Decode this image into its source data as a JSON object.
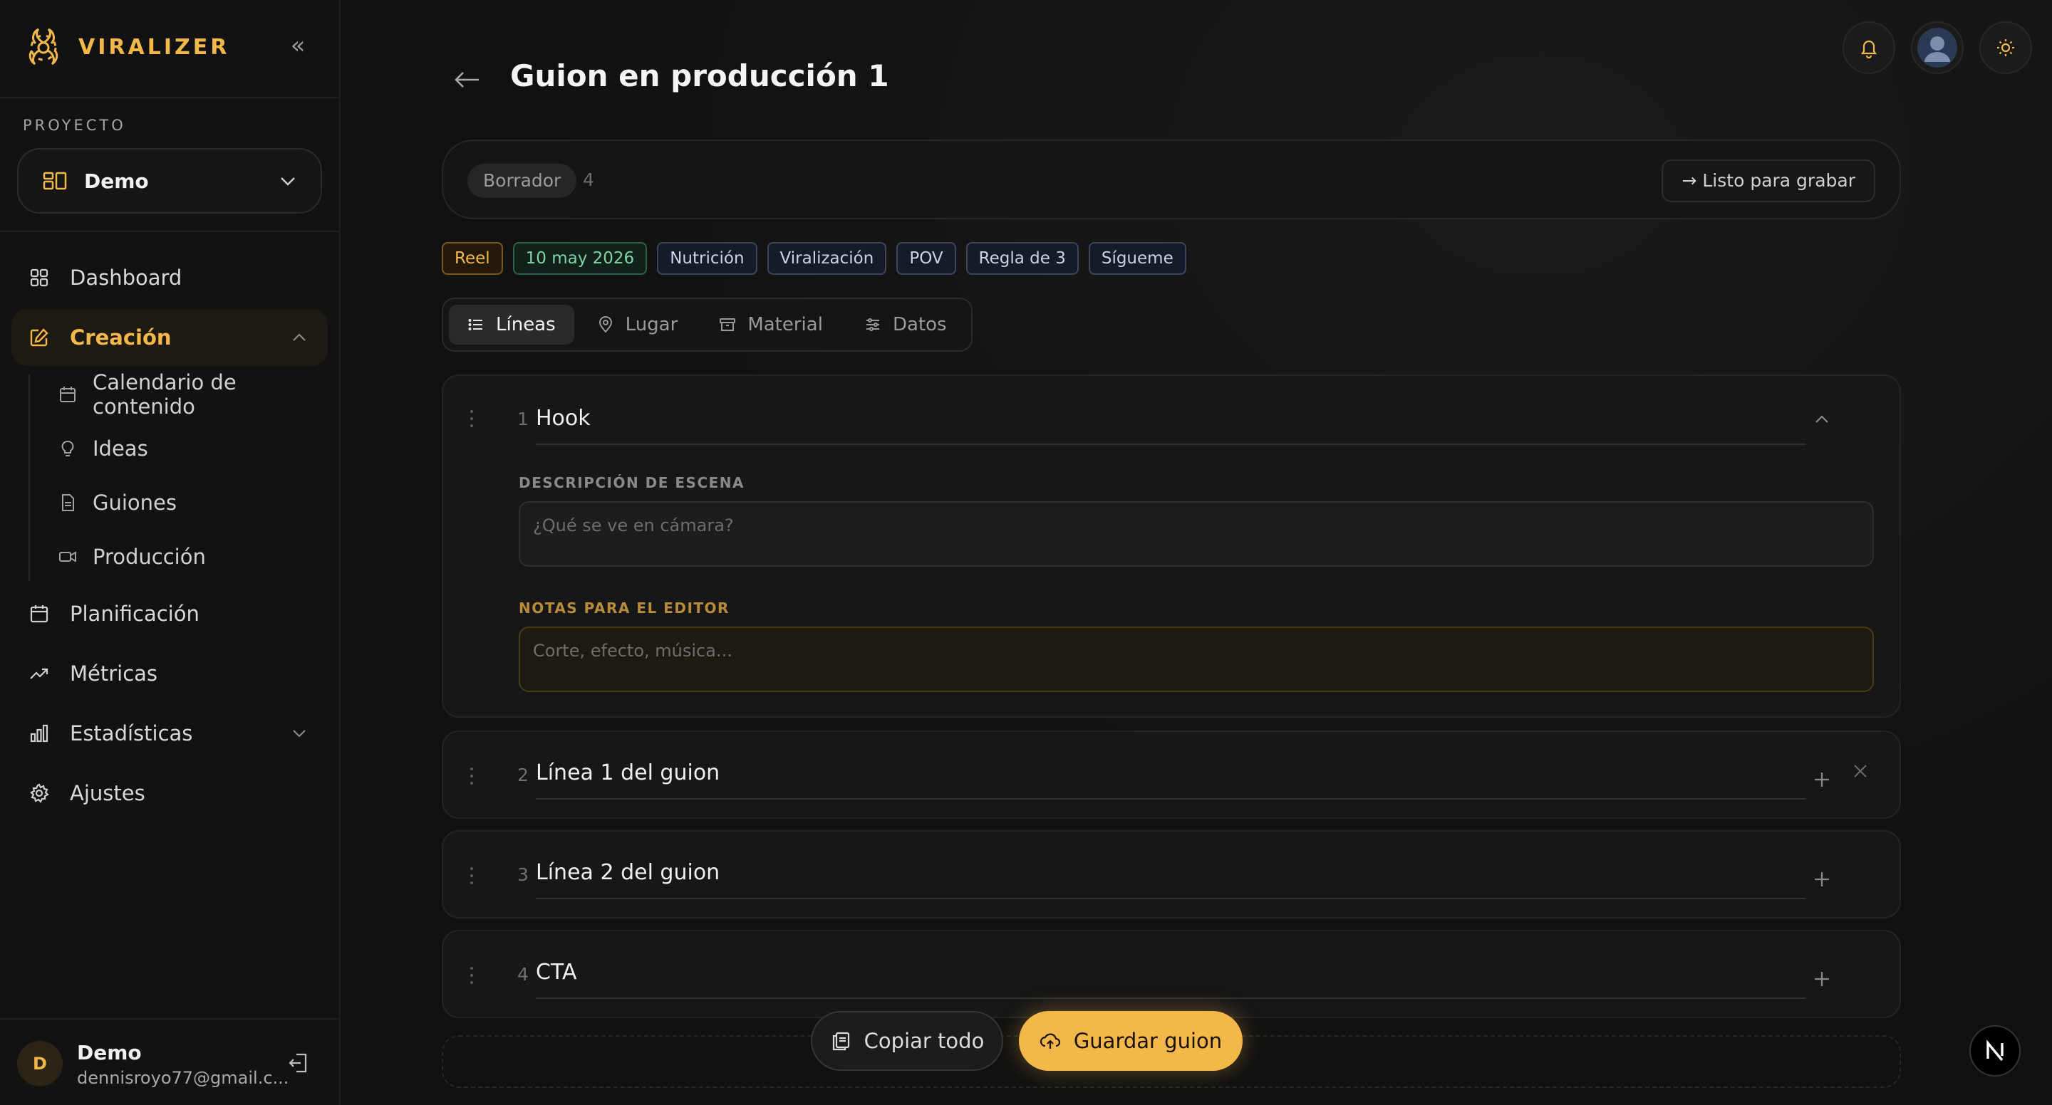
{
  "brand": {
    "name": "VIRALIZER"
  },
  "colors": {
    "accent": "#f4b84a",
    "background": "#111111",
    "sidebar": "#121212",
    "tag_blue": "#151b27",
    "tag_green": "#7fd4a4"
  },
  "project": {
    "label": "PROYECTO",
    "name": "Demo"
  },
  "nav": {
    "dashboard": "Dashboard",
    "creacion": "Creación",
    "sub": {
      "calendario": "Calendario de contenido",
      "ideas": "Ideas",
      "guiones": "Guiones",
      "produccion": "Producción"
    },
    "planificacion": "Planificación",
    "metricas": "Métricas",
    "estadisticas": "Estadísticas",
    "ajustes": "Ajustes"
  },
  "user": {
    "initial": "D",
    "name": "Demo",
    "email": "dennisroyo77@gmail.c..."
  },
  "header": {
    "title": "Guion en producción 1"
  },
  "status": {
    "label": "Borrador",
    "count": "4",
    "next_action": "→ Listo para grabar"
  },
  "tags": [
    {
      "label": "Reel",
      "style": "orange"
    },
    {
      "label": "10 may 2026",
      "style": "green"
    },
    {
      "label": "Nutrición",
      "style": "blue"
    },
    {
      "label": "Viralización",
      "style": "blue"
    },
    {
      "label": "POV",
      "style": "blue"
    },
    {
      "label": "Regla de 3",
      "style": "blue"
    },
    {
      "label": "Sígueme",
      "style": "blue"
    }
  ],
  "tabs": [
    {
      "label": "Líneas",
      "icon": "list-icon",
      "active": true
    },
    {
      "label": "Lugar",
      "icon": "map-pin-icon",
      "active": false
    },
    {
      "label": "Material",
      "icon": "archive-icon",
      "active": false
    },
    {
      "label": "Datos",
      "icon": "sliders-icon",
      "active": false
    }
  ],
  "lines": [
    {
      "num": "1",
      "title": "Hook",
      "expanded": true,
      "scene_label": "DESCRIPCIÓN DE ESCENA",
      "scene_placeholder": "¿Qué se ve en cámara?",
      "notes_label": "NOTAS PARA EL EDITOR",
      "notes_placeholder": "Corte, efecto, música..."
    },
    {
      "num": "2",
      "title": "Línea 1 del guion"
    },
    {
      "num": "3",
      "title": "Línea 2 del guion"
    },
    {
      "num": "4",
      "title": "CTA"
    }
  ],
  "actions": {
    "copy": "Copiar todo",
    "save": "Guardar guion"
  },
  "badge": {
    "letter": "N"
  }
}
